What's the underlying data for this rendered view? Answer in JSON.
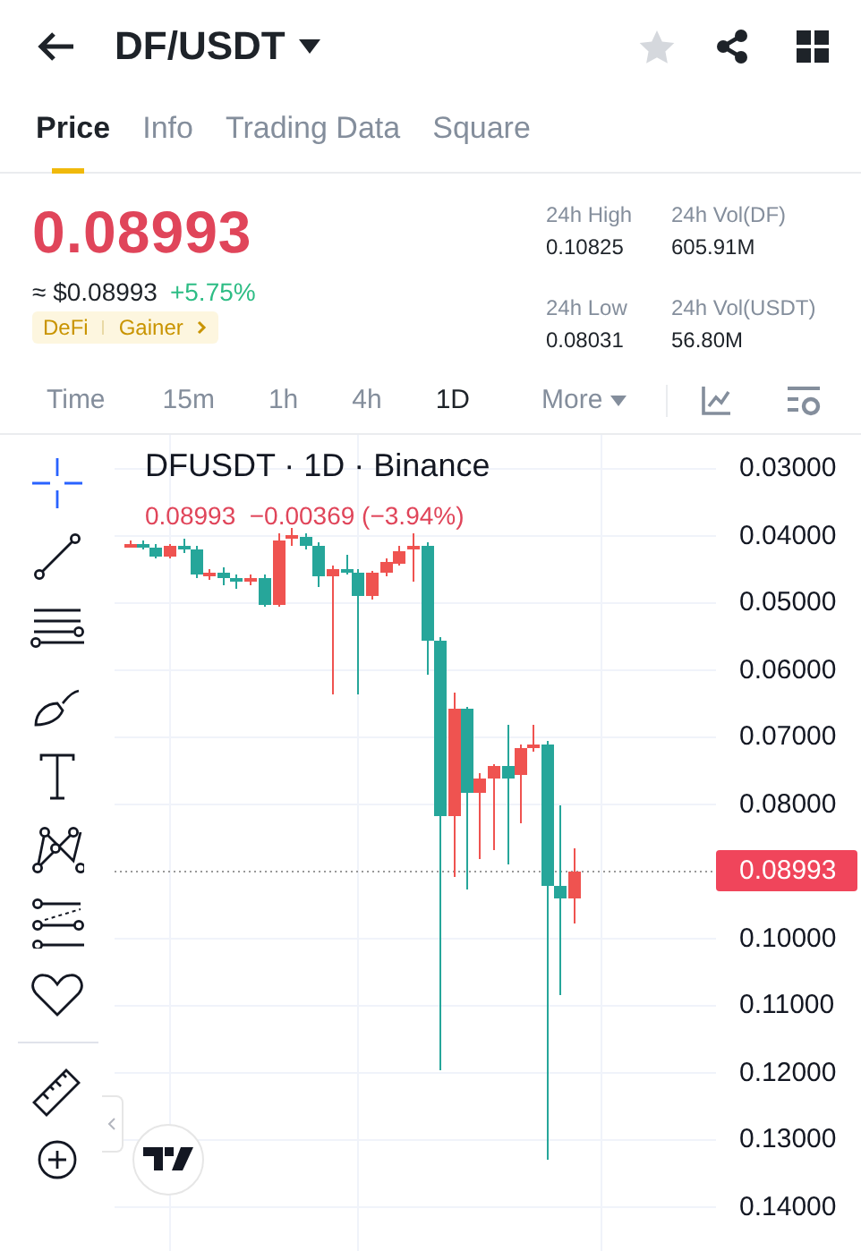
{
  "header": {
    "title": "DF/USDT",
    "favorite": false
  },
  "tabs": [
    {
      "label": "Price",
      "selected": true
    },
    {
      "label": "Info",
      "selected": false
    },
    {
      "label": "Trading Data",
      "selected": false
    },
    {
      "label": "Square",
      "selected": false
    }
  ],
  "price": {
    "last": "0.08993",
    "usd": "≈ $0.08993",
    "change": "+5.75%",
    "tags": [
      "DeFi",
      "Gainer"
    ]
  },
  "stats": [
    {
      "label": "24h High",
      "value": "0.10825"
    },
    {
      "label": "24h Vol(DF)",
      "value": "605.91M"
    },
    {
      "label": "24h Low",
      "value": "0.08031"
    },
    {
      "label": "24h Vol(USDT)",
      "value": "56.80M"
    }
  ],
  "intervals": [
    {
      "label": "Time",
      "selected": false
    },
    {
      "label": "15m",
      "selected": false
    },
    {
      "label": "1h",
      "selected": false
    },
    {
      "label": "4h",
      "selected": false
    },
    {
      "label": "1D",
      "selected": true
    },
    {
      "label": "More",
      "selected": false
    }
  ],
  "chart": {
    "title": "DFUSDT · 1D · Binance",
    "quote": "0.08993  −0.00369 (−3.94%)",
    "last_price": "0.08993",
    "y_ticks": [
      "0.03000",
      "0.04000",
      "0.05000",
      "0.06000",
      "0.07000",
      "0.08000",
      "0.10000",
      "0.11000",
      "0.12000",
      "0.13000",
      "0.14000"
    ]
  }
}
